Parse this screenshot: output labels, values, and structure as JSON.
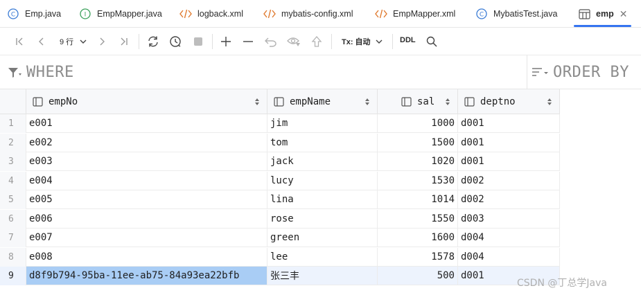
{
  "tabs": [
    {
      "label": "Emp.java",
      "icon": "class-icon",
      "active": false
    },
    {
      "label": "EmpMapper.java",
      "icon": "interface-icon",
      "active": false
    },
    {
      "label": "logback.xml",
      "icon": "xml-icon",
      "active": false
    },
    {
      "label": "mybatis-config.xml",
      "icon": "xml-icon",
      "active": false
    },
    {
      "label": "EmpMapper.xml",
      "icon": "xml-icon",
      "active": false
    },
    {
      "label": "MybatisTest.java",
      "icon": "class-icon",
      "active": false
    },
    {
      "label": "emp",
      "icon": "table-icon",
      "active": true
    }
  ],
  "toolbar": {
    "rows_label": "9 行",
    "tx_label": "Tx: 自动",
    "ddl_label": "DDL"
  },
  "filter": {
    "where_label": "WHERE",
    "orderby_label": "ORDER BY"
  },
  "grid": {
    "columns": [
      "empNo",
      "empName",
      "sal",
      "deptno"
    ],
    "rows": [
      {
        "n": "1",
        "empNo": "e001",
        "empName": "jim",
        "sal": "1000",
        "deptno": "d001"
      },
      {
        "n": "2",
        "empNo": "e002",
        "empName": "tom",
        "sal": "1500",
        "deptno": "d001"
      },
      {
        "n": "3",
        "empNo": "e003",
        "empName": "jack",
        "sal": "1020",
        "deptno": "d001"
      },
      {
        "n": "4",
        "empNo": "e004",
        "empName": "lucy",
        "sal": "1530",
        "deptno": "d002"
      },
      {
        "n": "5",
        "empNo": "e005",
        "empName": "lina",
        "sal": "1014",
        "deptno": "d002"
      },
      {
        "n": "6",
        "empNo": "e006",
        "empName": "rose",
        "sal": "1550",
        "deptno": "d003"
      },
      {
        "n": "7",
        "empNo": "e007",
        "empName": "green",
        "sal": "1600",
        "deptno": "d004"
      },
      {
        "n": "8",
        "empNo": "e008",
        "empName": "lee",
        "sal": "1578",
        "deptno": "d004"
      },
      {
        "n": "9",
        "empNo": "d8f9b794-95ba-11ee-ab75-84a93ea22bfb",
        "empName": "张三丰",
        "sal": "500",
        "deptno": "d001"
      }
    ]
  },
  "watermark": "CSDN @丁总学Java",
  "colors": {
    "accent": "#3574f0",
    "selection": "#a9cdf5",
    "row_selected": "#edf3fd"
  }
}
